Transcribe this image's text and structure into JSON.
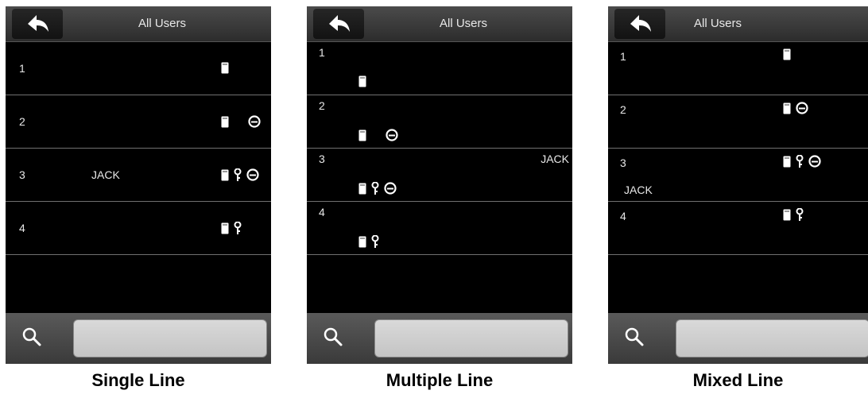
{
  "panels": [
    {
      "title": "All Users",
      "caption": "Single Line",
      "rows": [
        {
          "id": "1",
          "name": "",
          "icons": [
            "card"
          ]
        },
        {
          "id": "2",
          "name": "",
          "icons": [
            "card",
            "face"
          ]
        },
        {
          "id": "3",
          "name": "JACK",
          "icons": [
            "card",
            "key",
            "face"
          ]
        },
        {
          "id": "4",
          "name": "",
          "icons": [
            "card",
            "key"
          ]
        }
      ]
    },
    {
      "title": "All Users",
      "caption": "Multiple Line",
      "rows": [
        {
          "id": "1",
          "name": "",
          "icons": [
            "card"
          ]
        },
        {
          "id": "2",
          "name": "",
          "icons": [
            "card",
            "face"
          ]
        },
        {
          "id": "3",
          "name": "JACK",
          "icons": [
            "card",
            "key",
            "face"
          ]
        },
        {
          "id": "4",
          "name": "",
          "icons": [
            "card",
            "key"
          ]
        }
      ]
    },
    {
      "title": "All Users",
      "caption": "Mixed Line",
      "rows": [
        {
          "id": "1",
          "name": "",
          "icons": [
            "card"
          ]
        },
        {
          "id": "2",
          "name": "",
          "icons": [
            "card",
            "face"
          ]
        },
        {
          "id": "3",
          "name": "JACK",
          "icons": [
            "card",
            "key",
            "face"
          ]
        },
        {
          "id": "4",
          "name": "",
          "icons": [
            "card",
            "key"
          ]
        }
      ]
    }
  ]
}
